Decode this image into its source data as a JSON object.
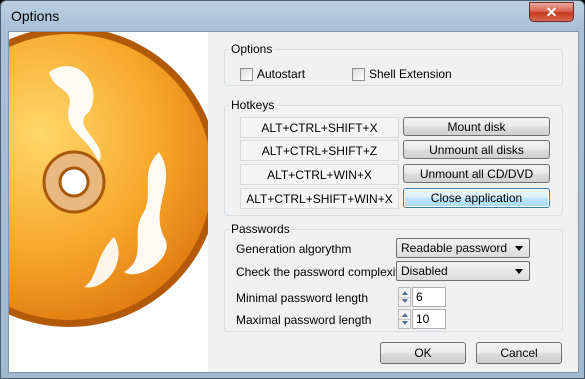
{
  "window": {
    "title": "Options",
    "close_glyph": "✕"
  },
  "icon": {
    "name": "cd-disc-icon",
    "colors": {
      "disc": "#f7a62a",
      "highlight": "#ffd86b",
      "hub": "#ffffff"
    }
  },
  "options": {
    "legend": "Options",
    "autostart": {
      "label": "Autostart",
      "checked": false
    },
    "shell_extension": {
      "label": "Shell Extension",
      "checked": false
    }
  },
  "hotkeys": {
    "legend": "Hotkeys",
    "rows": [
      {
        "keys": "ALT+CTRL+SHIFT+X",
        "action": "Mount disk"
      },
      {
        "keys": "ALT+CTRL+SHIFT+Z",
        "action": "Unmount all disks"
      },
      {
        "keys": "ALT+CTRL+WIN+X",
        "action": "Unmount all CD/DVD"
      },
      {
        "keys": "ALT+CTRL+SHIFT+WIN+X",
        "action": "Close application"
      }
    ]
  },
  "passwords": {
    "legend": "Passwords",
    "generation": {
      "label": "Generation algorythm",
      "value": "Readable password"
    },
    "complexity": {
      "label": "Check the password complexity",
      "value": "Disabled"
    },
    "min_length": {
      "label": "Minimal password length",
      "value": "6"
    },
    "max_length": {
      "label": "Maximal password length",
      "value": "10"
    }
  },
  "footer": {
    "ok_label": "OK",
    "cancel_label": "Cancel"
  }
}
